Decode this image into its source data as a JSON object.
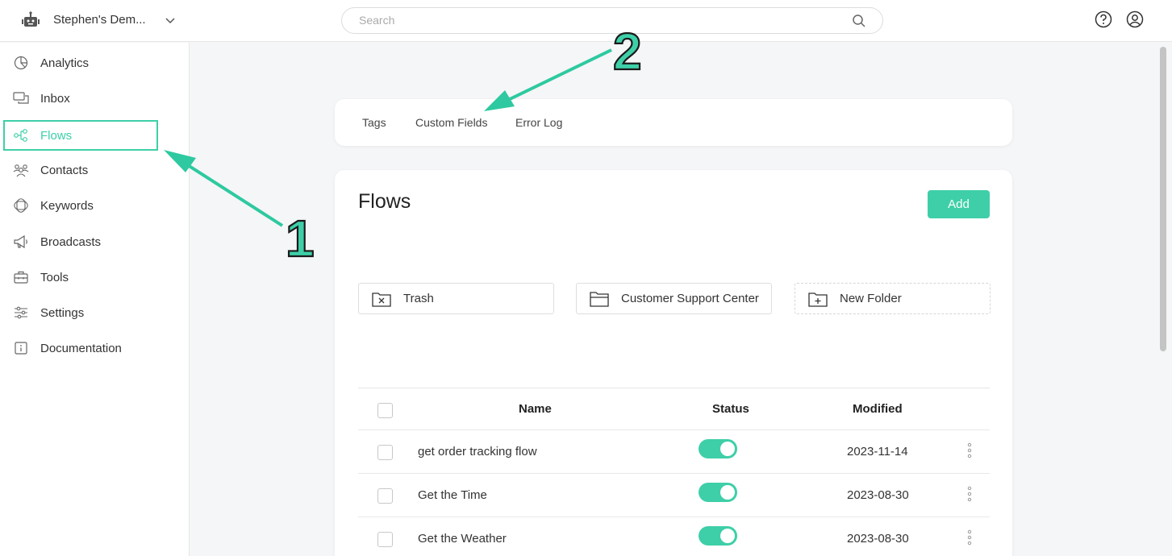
{
  "header": {
    "workspace_name": "Stephen's Dem...",
    "search_placeholder": "Search",
    "icons": [
      "bot-icon",
      "chevron-down-icon",
      "search-icon",
      "help-icon",
      "user-icon"
    ]
  },
  "sidebar": {
    "items": [
      {
        "label": "Analytics",
        "icon": "analytics-icon"
      },
      {
        "label": "Inbox",
        "icon": "inbox-icon"
      },
      {
        "label": "Flows",
        "icon": "flows-icon",
        "active": true
      },
      {
        "label": "Contacts",
        "icon": "contacts-icon"
      },
      {
        "label": "Keywords",
        "icon": "keywords-icon"
      },
      {
        "label": "Broadcasts",
        "icon": "megaphone-icon"
      },
      {
        "label": "Tools",
        "icon": "toolbox-icon"
      },
      {
        "label": "Settings",
        "icon": "sliders-icon"
      },
      {
        "label": "Documentation",
        "icon": "info-icon"
      }
    ]
  },
  "tabs": [
    "Tags",
    "Custom Fields",
    "Error Log"
  ],
  "flows": {
    "title": "Flows",
    "add_label": "Add",
    "folders": [
      {
        "label": "Trash",
        "icon": "trash-folder-icon"
      },
      {
        "label": "Customer Support Center",
        "icon": "folder-icon"
      },
      {
        "label": "New Folder",
        "icon": "new-folder-icon"
      }
    ],
    "columns": {
      "name": "Name",
      "status": "Status",
      "modified": "Modified"
    },
    "rows": [
      {
        "name": "get order tracking flow",
        "status_on": true,
        "modified": "2023-11-14"
      },
      {
        "name": "Get the Time",
        "status_on": true,
        "modified": "2023-08-30"
      },
      {
        "name": "Get the Weather",
        "status_on": true,
        "modified": "2023-08-30"
      }
    ]
  },
  "annotations": {
    "label_1": "1",
    "label_2": "2"
  },
  "colors": {
    "accent": "#3ecfa8",
    "annotation": "#2ec9a0"
  }
}
